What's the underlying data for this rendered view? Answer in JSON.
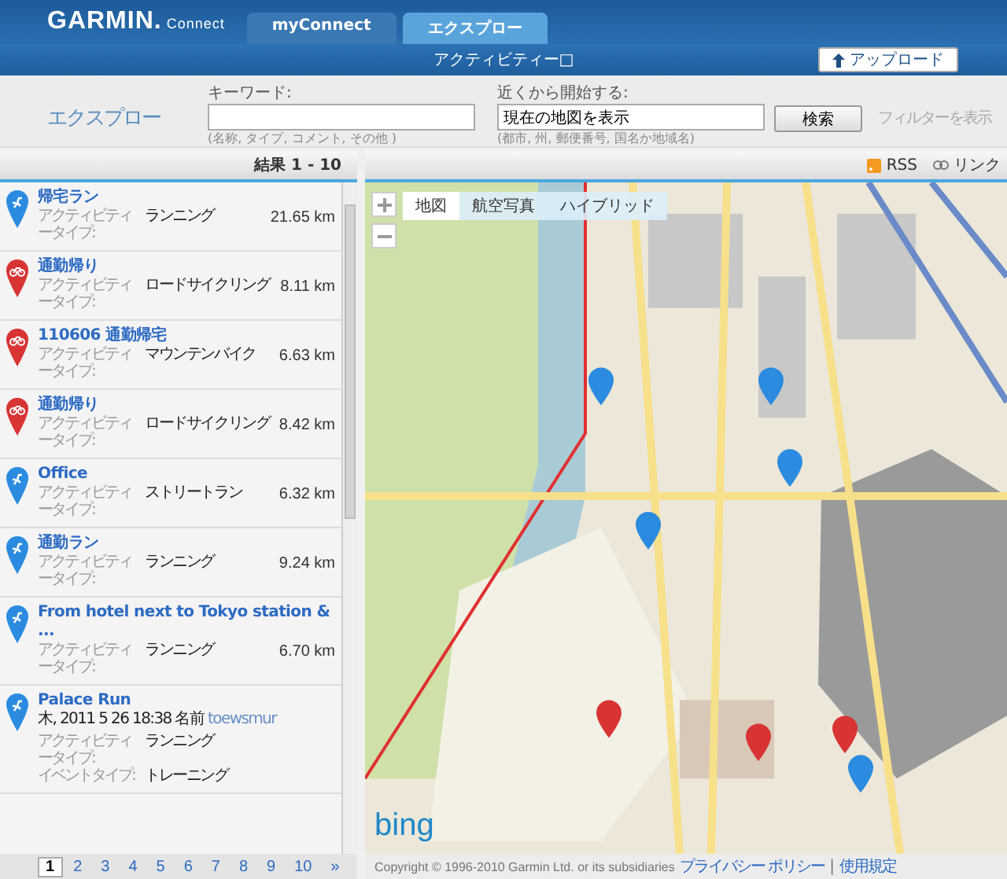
{
  "header": {
    "logo": "GARMIN.",
    "logo_sub": "Connect",
    "tabs": [
      {
        "label": "myConnect",
        "selected": false
      },
      {
        "label": "エクスプロー",
        "selected": true
      }
    ]
  },
  "subbar": {
    "title": "アクティビティー□",
    "upload_button": "アップロード"
  },
  "search": {
    "title": "エクスプロー",
    "keyword": {
      "label": "キーワード:",
      "hint": "(名称, タイプ, コメント, その他 )"
    },
    "near": {
      "label": "近くから開始する:",
      "value": "現在の地図を表示",
      "hint": "(都市, 州, 郵便番号, 国名か地域名)"
    },
    "search_button": "検索",
    "filter_link": "フィルターを表示"
  },
  "results": {
    "header": "結果 1 - 10",
    "items": [
      {
        "kind": "running",
        "title": "帰宅ラン",
        "type_label": "アクティビティータイプ:",
        "type": "ランニング",
        "distance": "21.65 km"
      },
      {
        "kind": "cycling",
        "title": "通勤帰り",
        "type_label": "アクティビティータイプ:",
        "type": "ロードサイクリング",
        "distance": "8.11 km"
      },
      {
        "kind": "cycling",
        "title": "110606 通勤帰宅",
        "type_label": "アクティビティータイプ:",
        "type": "マウンテンバイク",
        "distance": "6.63 km"
      },
      {
        "kind": "cycling",
        "title": "通勤帰り",
        "type_label": "アクティビティータイプ:",
        "type": "ロードサイクリング",
        "distance": "8.42 km"
      },
      {
        "kind": "running",
        "title": "Office",
        "type_label": "アクティビティータイプ:",
        "type": "ストリートラン",
        "distance": "6.32 km"
      },
      {
        "kind": "running",
        "title": "通勤ラン",
        "type_label": "アクティビティータイプ:",
        "type": "ランニング",
        "distance": "9.24 km"
      },
      {
        "kind": "running",
        "title": "From hotel next to Tokyo station & ...",
        "type_label": "アクティビティータイプ:",
        "type": "ランニング",
        "distance": "6.70 km"
      },
      {
        "kind": "running",
        "title": "Palace Run",
        "date": "木, 2011 5 26 18:38 名前",
        "user": "toewsmur",
        "type_label": "アクティビティータイプ:",
        "type": "ランニング",
        "event_label": "イベントタイプ:",
        "event": "トレーニング"
      }
    ],
    "pages": [
      {
        "label": "1",
        "selected": true
      },
      {
        "label": "2",
        "selected": false
      },
      {
        "label": "3",
        "selected": false
      },
      {
        "label": "4",
        "selected": false
      },
      {
        "label": "5",
        "selected": false
      },
      {
        "label": "6",
        "selected": false
      },
      {
        "label": "7",
        "selected": false
      },
      {
        "label": "8",
        "selected": false
      },
      {
        "label": "9",
        "selected": false
      },
      {
        "label": "10",
        "selected": false
      }
    ],
    "next": "»"
  },
  "map": {
    "rss": "RSS",
    "link": "リンク",
    "map_types": [
      {
        "label": "地図",
        "selected": true
      },
      {
        "label": "航空写真",
        "selected": false
      },
      {
        "label": "ハイブリッド",
        "selected": false
      }
    ],
    "logo": "bing"
  },
  "footer": {
    "copyright": "Copyright © 1996-2010 Garmin Ltd. or its subsidiaries",
    "privacy": "プライバシー ポリシー",
    "separator": "|",
    "terms": "使用規定"
  }
}
